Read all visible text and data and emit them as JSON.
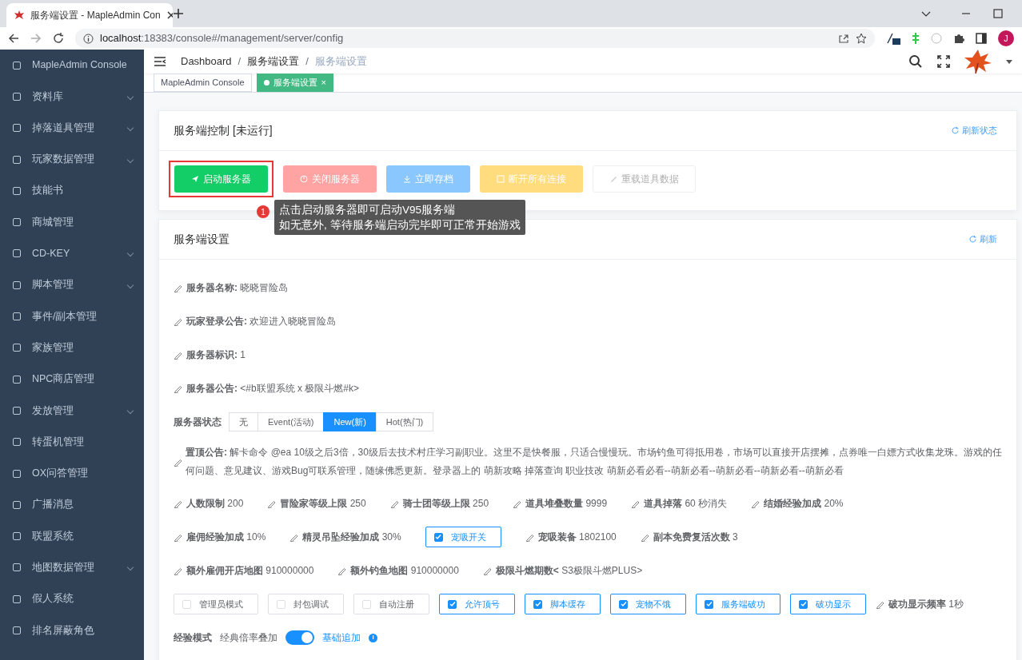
{
  "browser": {
    "tab_title": "服务端设置 - MapleAdmin Con",
    "url_host": "localhost",
    "url_rest": ":18383/console#/management/server/config",
    "profile_initial": "J"
  },
  "sidebar": {
    "items": [
      {
        "label": "MapleAdmin Console",
        "expandable": false
      },
      {
        "label": "资料库",
        "expandable": true
      },
      {
        "label": "掉落道具管理",
        "expandable": true
      },
      {
        "label": "玩家数据管理",
        "expandable": true
      },
      {
        "label": "技能书",
        "expandable": false
      },
      {
        "label": "商城管理",
        "expandable": false
      },
      {
        "label": "CD-KEY",
        "expandable": true
      },
      {
        "label": "脚本管理",
        "expandable": true
      },
      {
        "label": "事件/副本管理",
        "expandable": false
      },
      {
        "label": "家族管理",
        "expandable": false
      },
      {
        "label": "NPC商店管理",
        "expandable": false
      },
      {
        "label": "发放管理",
        "expandable": true
      },
      {
        "label": "转蛋机管理",
        "expandable": false
      },
      {
        "label": "OX问答管理",
        "expandable": false
      },
      {
        "label": "广播消息",
        "expandable": false
      },
      {
        "label": "联盟系统",
        "expandable": false
      },
      {
        "label": "地图数据管理",
        "expandable": true
      },
      {
        "label": "假人系统",
        "expandable": false
      },
      {
        "label": "排名屏蔽角色",
        "expandable": false
      }
    ]
  },
  "breadcrumb": [
    "Dashboard",
    "服务端设置",
    "服务端设置"
  ],
  "breadcrumb_separator": "/",
  "tags": [
    {
      "label": "MapleAdmin Console",
      "selected": false,
      "closable": false
    },
    {
      "label": "服务端设置",
      "selected": true,
      "closable": true
    }
  ],
  "tag_close": "×",
  "control": {
    "title": "服务端控制 [未运行]",
    "refresh": "刷新状态",
    "buttons": [
      {
        "label": "启动服务器",
        "kind": "success",
        "disabled": false,
        "highlighted": true
      },
      {
        "label": "关闭服务器",
        "kind": "danger",
        "disabled": true,
        "highlighted": false
      },
      {
        "label": "立即存档",
        "kind": "primary",
        "disabled": true,
        "highlighted": false
      },
      {
        "label": "断开所有连接",
        "kind": "warning",
        "disabled": true,
        "highlighted": false
      },
      {
        "label": "重载道具数据",
        "kind": "light",
        "disabled": true,
        "highlighted": false
      }
    ],
    "tooltip": {
      "step": "1",
      "lines": [
        "点击启动服务器即可启动V95服务端",
        "如无意外, 等待服务端启动完毕即可正常开始游戏"
      ]
    }
  },
  "settings": {
    "title": "服务端设置",
    "refresh": "刷新",
    "fields": [
      {
        "label": "服务器名称:",
        "value": "晓晓冒险岛"
      },
      {
        "label": "玩家登录公告:",
        "value": "欢迎进入晓晓冒险岛"
      },
      {
        "label": "服务器标识:",
        "value": "1"
      },
      {
        "label": "服务器公告:",
        "value": "<#b联盟系统 x 极限斗燃#k>"
      }
    ],
    "status": {
      "label": "服务器状态",
      "options": [
        {
          "label": "无",
          "selected": false
        },
        {
          "label": "Event(活动)",
          "selected": false
        },
        {
          "label": "New(新)",
          "selected": true
        },
        {
          "label": "Hot(热门)",
          "selected": false
        }
      ]
    },
    "notice": {
      "label": "置顶公告:",
      "value": "解卡命令 @ea 10级之后3倍，30级后去技术村庄学习副职业。这里不是快餐服，只适合慢慢玩。市场钓鱼可得抵用卷，市场可以直接开店摆摊，点券唯一白嫖方式收集龙珠。游戏的任何问题、意见建议、游戏Bug可联系管理，随缘佛悉更新。登录器上的 萌新攻略 掉落查询 职业技改 萌新必看必看--萌新必看--萌新必看--萌新必看--萌新必看"
    },
    "rows": [
      {
        "items": [
          {
            "kind": "field",
            "label": "人数限制",
            "value": "200"
          },
          {
            "kind": "field",
            "label": "冒险家等级上限",
            "value": "250"
          },
          {
            "kind": "field",
            "label": "骑士团等级上限",
            "value": "250"
          },
          {
            "kind": "field",
            "label": "道具堆叠数量",
            "value": "9999"
          },
          {
            "kind": "field",
            "label": "道具掉落",
            "value": "60 秒消失"
          },
          {
            "kind": "field",
            "label": "结婚经验加成",
            "value": "20%"
          }
        ]
      },
      {
        "items": [
          {
            "kind": "field",
            "label": "雇佣经验加成",
            "value": "10%"
          },
          {
            "kind": "field",
            "label": "精灵吊坠经验加成",
            "value": "30%"
          },
          {
            "kind": "checkbox",
            "label": "宠吸开关",
            "checked": true
          },
          {
            "kind": "field",
            "label": "宠吸装备",
            "value": "1802100"
          },
          {
            "kind": "field",
            "label": "副本免费复活次数",
            "value": "3"
          }
        ]
      },
      {
        "items": [
          {
            "kind": "field",
            "label": "额外雇佣开店地图",
            "value": "910000000"
          },
          {
            "kind": "field",
            "label": "额外钓鱼地图",
            "value": "910000000"
          },
          {
            "kind": "field",
            "label": "极限斗燃期数<",
            "value": "S3极限斗燃PLUS>"
          }
        ]
      },
      {
        "items": [
          {
            "kind": "checkbox",
            "label": "管理员模式",
            "checked": false
          },
          {
            "kind": "checkbox",
            "label": "封包调试",
            "checked": false
          },
          {
            "kind": "checkbox",
            "label": "自动注册",
            "checked": false
          },
          {
            "kind": "checkbox",
            "label": "允许顶号",
            "checked": true
          },
          {
            "kind": "checkbox",
            "label": "脚本缓存",
            "checked": true
          },
          {
            "kind": "checkbox",
            "label": "宠物不饿",
            "checked": true
          },
          {
            "kind": "checkbox",
            "label": "服务端破功",
            "checked": true
          },
          {
            "kind": "checkbox",
            "label": "破功显示",
            "checked": true
          },
          {
            "kind": "field",
            "label": "破功显示频率",
            "value": "1秒"
          }
        ]
      }
    ],
    "exp_mode": {
      "label": "经验模式",
      "off_label": "经典倍率叠加",
      "on": true,
      "on_label": "基础追加",
      "info": "i"
    }
  }
}
